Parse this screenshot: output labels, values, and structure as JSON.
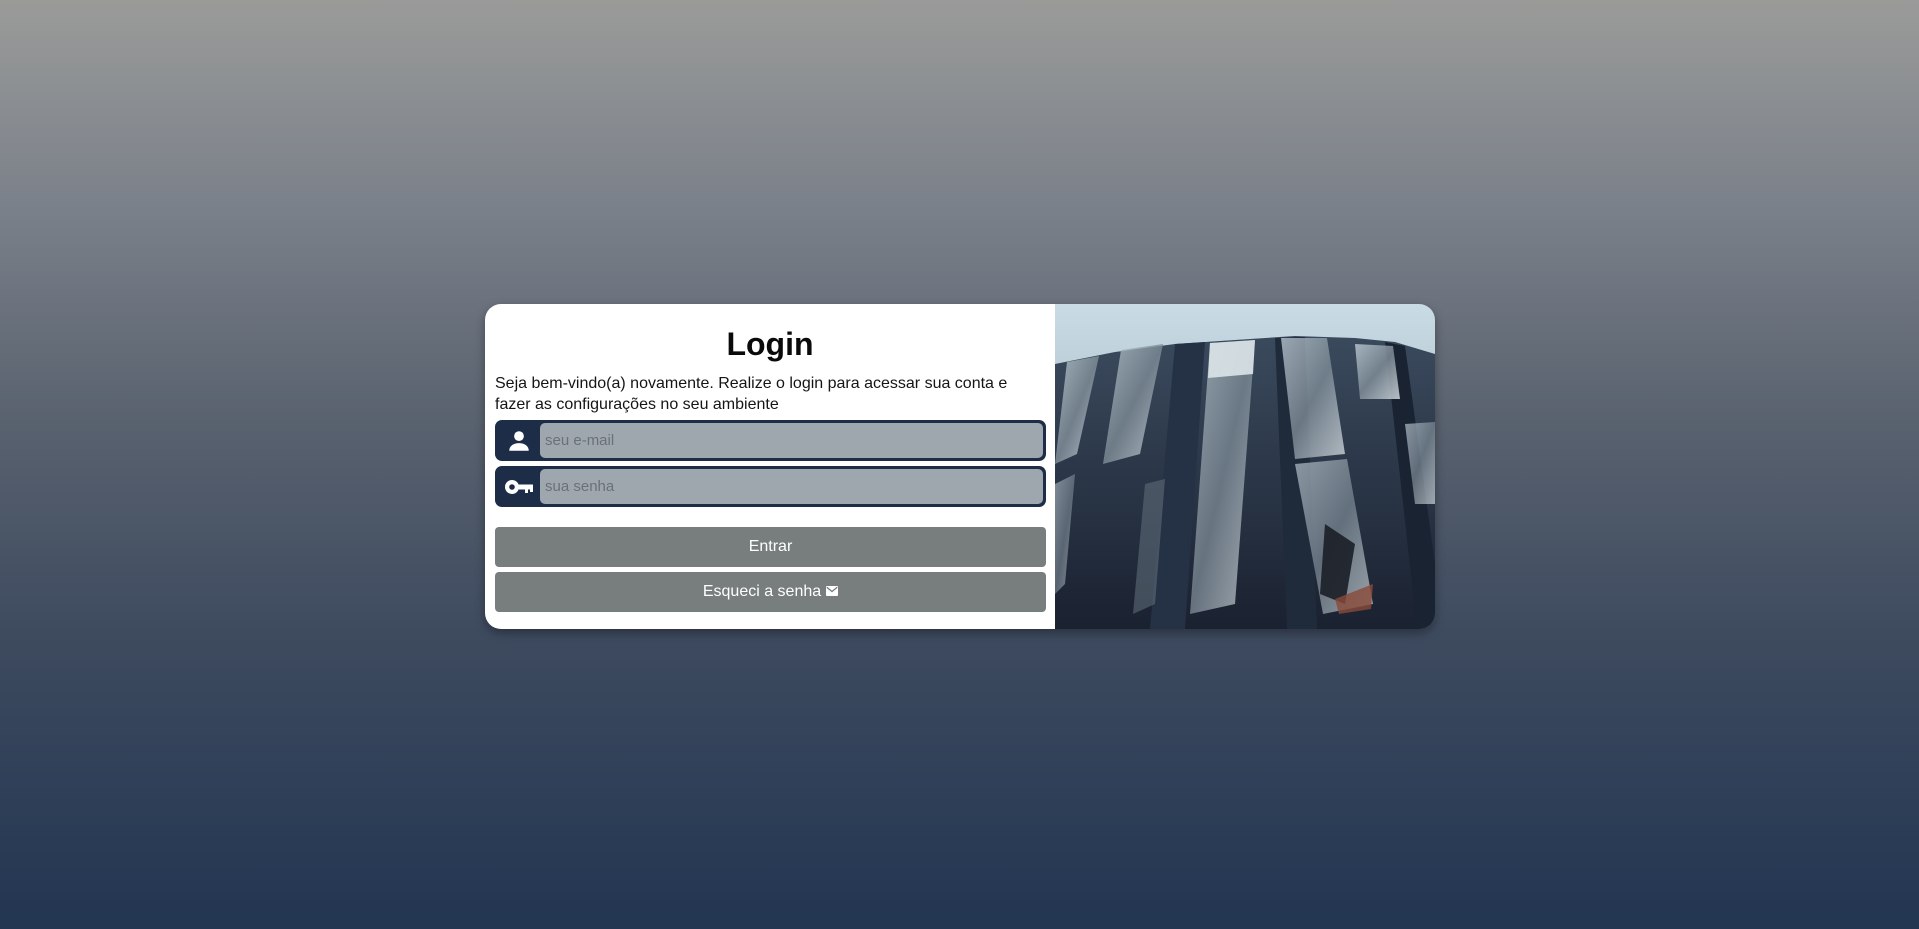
{
  "login": {
    "title": "Login",
    "subtitle": "Seja bem-vindo(a) novamente. Realize o login para acessar sua conta e fazer as configurações no seu ambiente",
    "email_placeholder": "seu e-mail",
    "password_placeholder": "sua senha",
    "submit_label": "Entrar",
    "forgot_label": "Esqueci a senha"
  },
  "icons": {
    "email_field": "user-icon",
    "password_field": "key-icon",
    "forgot_button": "envelope-icon"
  },
  "colors": {
    "field_frame": "#1d2d48",
    "field_fill": "#9ea7ad",
    "button": "#787d7e"
  }
}
